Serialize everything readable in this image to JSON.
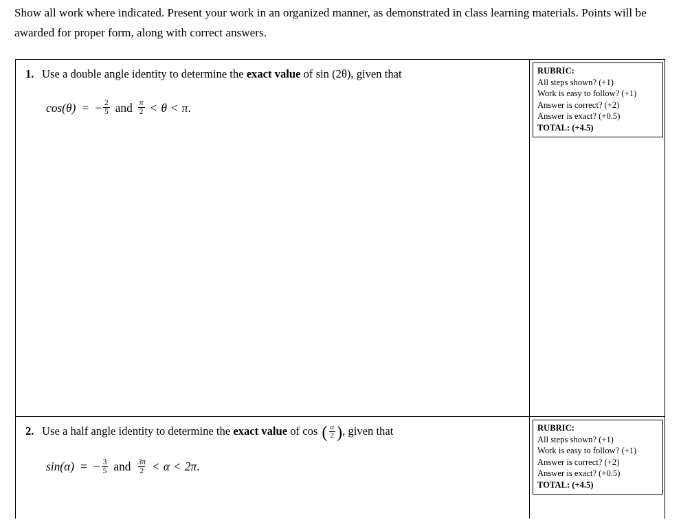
{
  "document": {
    "instructions": "Show all work where indicated.  Present your work in an organized manner, as demonstrated in class learning materials.  Points will be awarded for proper form, along with correct answers."
  },
  "rubric": {
    "title": "RUBRIC:",
    "items": [
      "All steps shown? (+1)",
      "Work is easy to follow? (+1)",
      "Answer is correct? (+2)",
      "Answer is exact? (+0.5)"
    ],
    "total": "TOTAL: (+4.5)"
  },
  "questions": [
    {
      "number": "1.",
      "prompt_part_1": "Use a double angle identity to determine the ",
      "prompt_bold": "exact value",
      "prompt_part_2": " of sin (2θ), given that",
      "equation": {
        "lhs": "cos(θ)",
        "equals": "=",
        "sign": "−",
        "frac_num": "2",
        "frac_den": "5",
        "conjunction": "and",
        "range_num": "π",
        "range_den": "2",
        "rel_1": "<",
        "var": "θ",
        "rel_2": "<",
        "upper": "π",
        "period": "."
      }
    },
    {
      "number": "2.",
      "prompt_part_1": "Use a half angle identity to determine the ",
      "prompt_bold": "exact value",
      "prompt_part_2": " of cos",
      "prompt_arg_num": "α",
      "prompt_arg_den": "2",
      "prompt_part_3": ", given that",
      "equation": {
        "lhs": "sin(α)",
        "equals": "=",
        "sign": "−",
        "frac_num": "3",
        "frac_den": "5",
        "conjunction": "and",
        "range_num": "3π",
        "range_den": "2",
        "rel_1": "<",
        "var": "α",
        "rel_2": "<",
        "upper": "2π",
        "period": "."
      }
    }
  ]
}
